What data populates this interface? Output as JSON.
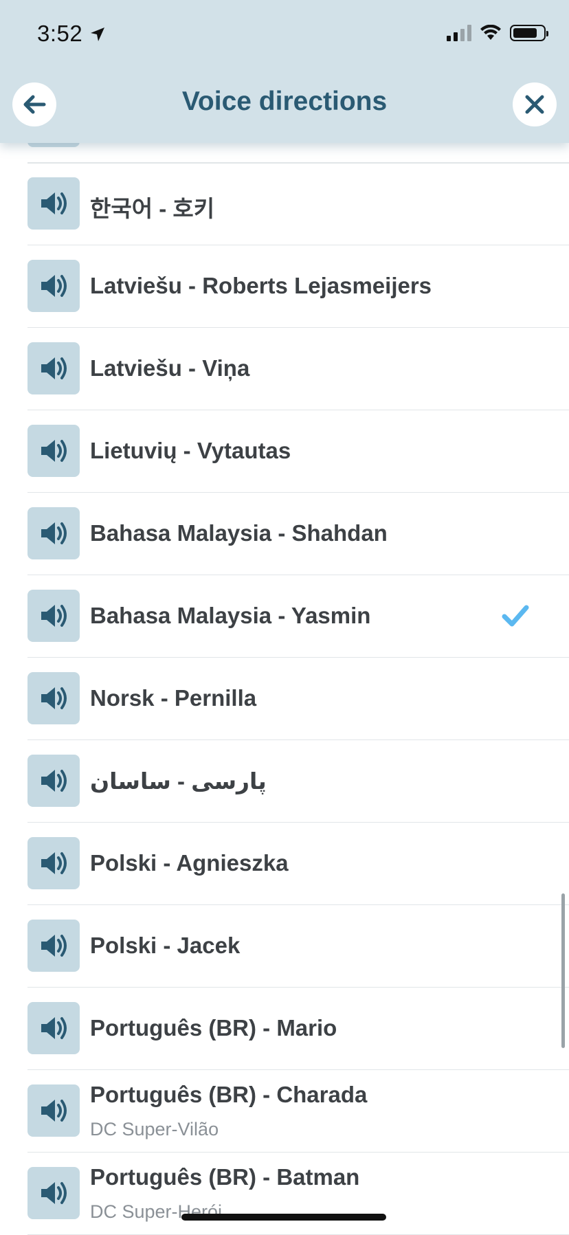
{
  "status": {
    "time": "3:52"
  },
  "header": {
    "title": "Voice directions"
  },
  "colors": {
    "header_bg": "#d2e1e8",
    "title": "#2a5a73",
    "speaker_bg": "#c5d9e2",
    "check": "#5bb8f0"
  },
  "voices": [
    {
      "label": "한국어 - 호키",
      "subtitle": "",
      "selected": false
    },
    {
      "label": "Latviešu - Roberts Lejasmeijers",
      "subtitle": "",
      "selected": false
    },
    {
      "label": "Latviešu - Viņa",
      "subtitle": "",
      "selected": false
    },
    {
      "label": "Lietuvių - Vytautas",
      "subtitle": "",
      "selected": false
    },
    {
      "label": "Bahasa Malaysia - Shahdan",
      "subtitle": "",
      "selected": false
    },
    {
      "label": "Bahasa Malaysia - Yasmin",
      "subtitle": "",
      "selected": true
    },
    {
      "label": "Norsk - Pernilla",
      "subtitle": "",
      "selected": false
    },
    {
      "label": "پارسی - ساسان",
      "subtitle": "",
      "selected": false
    },
    {
      "label": "Polski - Agnieszka",
      "subtitle": "",
      "selected": false
    },
    {
      "label": "Polski - Jacek",
      "subtitle": "",
      "selected": false
    },
    {
      "label": "Português (BR) - Mario",
      "subtitle": "",
      "selected": false
    },
    {
      "label": "Português (BR) - Charada",
      "subtitle": "DC Super-Vilão",
      "selected": false
    },
    {
      "label": "Português (BR) - Batman",
      "subtitle": "DC Super-Herói",
      "selected": false
    }
  ]
}
